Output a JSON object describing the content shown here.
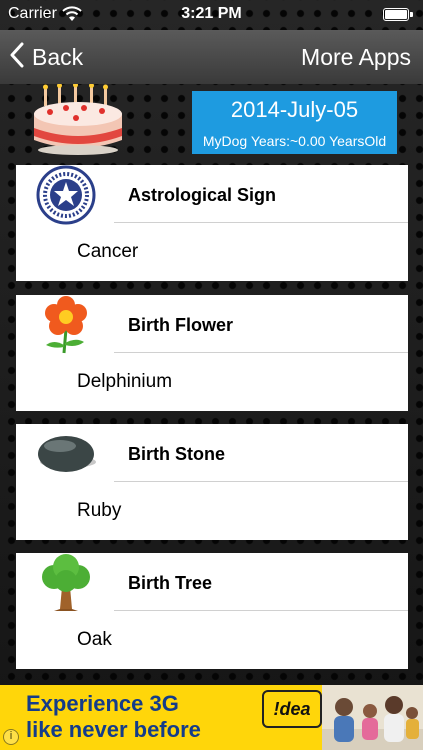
{
  "status_bar": {
    "carrier": "Carrier",
    "time": "3:21 PM",
    "battery_percent": 100
  },
  "nav": {
    "back_label": "Back",
    "more_apps_label": "More Apps"
  },
  "header": {
    "date": "2014-July-05",
    "age_text": "MyDog Years:~0.00 YearsOld",
    "date_box_color": "#1e9be0"
  },
  "cards": [
    {
      "title": "Astrological Sign",
      "value": "Cancer",
      "icon": "zodiac-wheel-icon"
    },
    {
      "title": "Birth Flower",
      "value": "Delphinium",
      "icon": "flower-icon"
    },
    {
      "title": "Birth Stone",
      "value": "Ruby",
      "icon": "stone-icon"
    },
    {
      "title": "Birth Tree",
      "value": "Oak",
      "icon": "tree-icon"
    }
  ],
  "ad": {
    "headline_line1": "Experience 3G",
    "headline_line2": "like never before",
    "brand": "!dea",
    "info_glyph": "i",
    "background_color": "#ffd60a",
    "text_color": "#143c8a"
  }
}
